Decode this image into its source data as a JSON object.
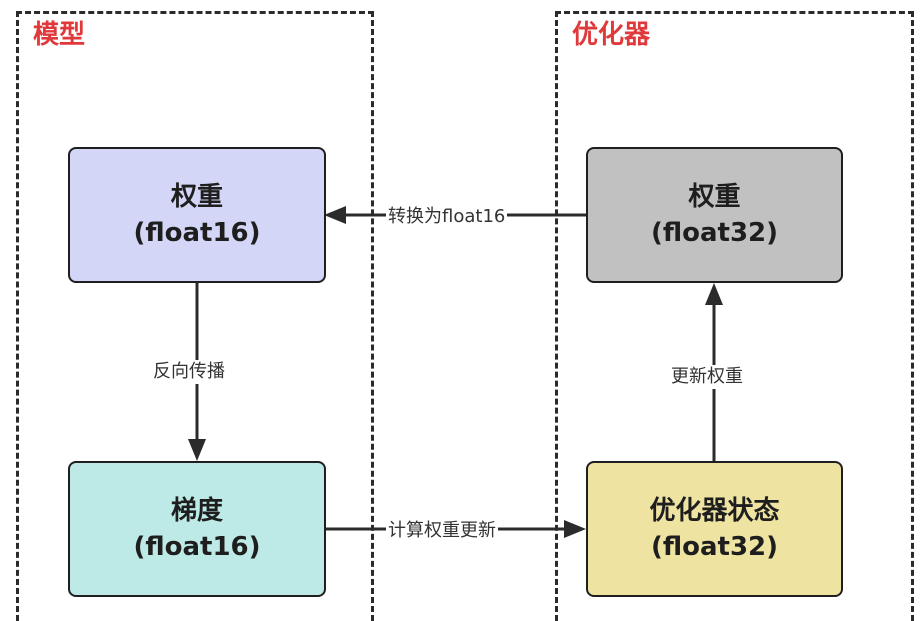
{
  "colors": {
    "title_red": "#e0393b",
    "weights16_fill": "#d3d6f6",
    "grads16_fill": "#bdeae6",
    "weights32_fill": "#c1c1c1",
    "optstate_fill": "#efe3a2",
    "line": "#2b2b2b"
  },
  "regions": {
    "model_title": "模型",
    "optimizer_title": "优化器"
  },
  "nodes": {
    "weights_fp16": {
      "line1": "权重",
      "line2": "(float16)"
    },
    "gradients_fp16": {
      "line1": "梯度",
      "line2": "(float16)"
    },
    "weights_fp32": {
      "line1": "权重",
      "line2": "(float32)"
    },
    "optimizer_state": {
      "line1": "优化器状态",
      "line2": "(float32)"
    }
  },
  "edges": {
    "convert": "转换为float16",
    "backprop": "反向传播",
    "update": "更新权重",
    "compute": "计算权重更新"
  }
}
